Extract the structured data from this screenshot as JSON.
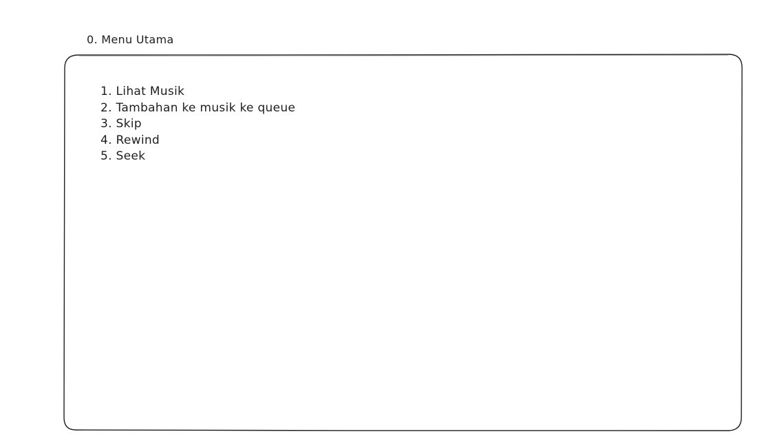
{
  "title": "0. Menu Utama",
  "menu": {
    "items": [
      {
        "label": "1. Lihat Musik"
      },
      {
        "label": "2. Tambahan ke musik ke queue"
      },
      {
        "label": "3. Skip"
      },
      {
        "label": "4. Rewind"
      },
      {
        "label": "5. Seek"
      }
    ]
  },
  "colors": {
    "stroke": "#1e1e1e",
    "background": "#ffffff"
  }
}
